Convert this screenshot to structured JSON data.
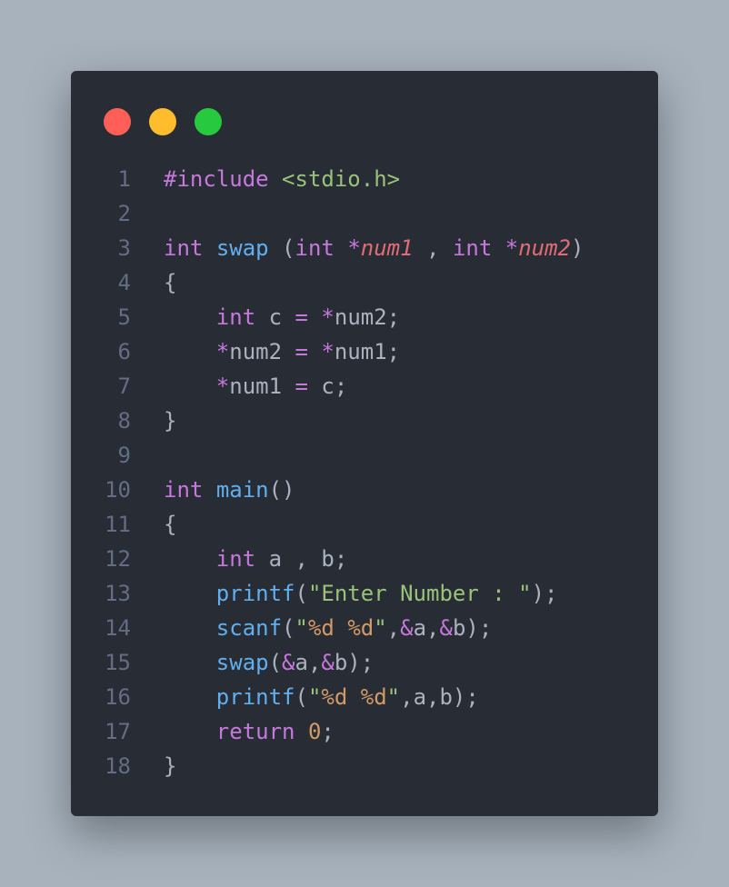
{
  "window": {
    "controls": {
      "close_color": "#ff5f56",
      "minimize_color": "#ffbd2e",
      "maximize_color": "#27c93f"
    }
  },
  "editor": {
    "language": "c",
    "lines": [
      {
        "number": "1",
        "tokens": [
          {
            "text": "#include",
            "class": "kw"
          },
          {
            "text": " ",
            "class": "txtc"
          },
          {
            "text": "<stdio.h>",
            "class": "str"
          }
        ]
      },
      {
        "number": "2",
        "tokens": []
      },
      {
        "number": "3",
        "tokens": [
          {
            "text": "int",
            "class": "kw"
          },
          {
            "text": " ",
            "class": "txtc"
          },
          {
            "text": "swap",
            "class": "fn"
          },
          {
            "text": " (",
            "class": "txtc"
          },
          {
            "text": "int",
            "class": "kw"
          },
          {
            "text": " ",
            "class": "txtc"
          },
          {
            "text": "*",
            "class": "kw"
          },
          {
            "text": "num1",
            "class": "param"
          },
          {
            "text": " , ",
            "class": "txtc"
          },
          {
            "text": "int",
            "class": "kw"
          },
          {
            "text": " ",
            "class": "txtc"
          },
          {
            "text": "*",
            "class": "kw"
          },
          {
            "text": "num2",
            "class": "param"
          },
          {
            "text": ")",
            "class": "txtc"
          }
        ]
      },
      {
        "number": "4",
        "tokens": [
          {
            "text": "{",
            "class": "txtc"
          }
        ]
      },
      {
        "number": "5",
        "tokens": [
          {
            "text": "    ",
            "class": "txtc"
          },
          {
            "text": "int",
            "class": "kw"
          },
          {
            "text": " c ",
            "class": "txtc"
          },
          {
            "text": "=",
            "class": "kw"
          },
          {
            "text": " ",
            "class": "txtc"
          },
          {
            "text": "*",
            "class": "kw"
          },
          {
            "text": "num2;",
            "class": "txtc"
          }
        ]
      },
      {
        "number": "6",
        "tokens": [
          {
            "text": "    ",
            "class": "txtc"
          },
          {
            "text": "*",
            "class": "kw"
          },
          {
            "text": "num2 ",
            "class": "txtc"
          },
          {
            "text": "=",
            "class": "kw"
          },
          {
            "text": " ",
            "class": "txtc"
          },
          {
            "text": "*",
            "class": "kw"
          },
          {
            "text": "num1;",
            "class": "txtc"
          }
        ]
      },
      {
        "number": "7",
        "tokens": [
          {
            "text": "    ",
            "class": "txtc"
          },
          {
            "text": "*",
            "class": "kw"
          },
          {
            "text": "num1 ",
            "class": "txtc"
          },
          {
            "text": "=",
            "class": "kw"
          },
          {
            "text": " c;",
            "class": "txtc"
          }
        ]
      },
      {
        "number": "8",
        "tokens": [
          {
            "text": "}",
            "class": "txtc"
          }
        ]
      },
      {
        "number": "9",
        "tokens": []
      },
      {
        "number": "10",
        "tokens": [
          {
            "text": "int",
            "class": "kw"
          },
          {
            "text": " ",
            "class": "txtc"
          },
          {
            "text": "main",
            "class": "fn"
          },
          {
            "text": "()",
            "class": "txtc"
          }
        ]
      },
      {
        "number": "11",
        "tokens": [
          {
            "text": "{",
            "class": "txtc"
          }
        ]
      },
      {
        "number": "12",
        "tokens": [
          {
            "text": "    ",
            "class": "txtc"
          },
          {
            "text": "int",
            "class": "kw"
          },
          {
            "text": " a , b;",
            "class": "txtc"
          }
        ]
      },
      {
        "number": "13",
        "tokens": [
          {
            "text": "    ",
            "class": "txtc"
          },
          {
            "text": "printf",
            "class": "fn"
          },
          {
            "text": "(",
            "class": "txtc"
          },
          {
            "text": "\"Enter Number : \"",
            "class": "str"
          },
          {
            "text": ");",
            "class": "txtc"
          }
        ]
      },
      {
        "number": "14",
        "tokens": [
          {
            "text": "    ",
            "class": "txtc"
          },
          {
            "text": "scanf",
            "class": "fn"
          },
          {
            "text": "(",
            "class": "txtc"
          },
          {
            "text": "\"",
            "class": "str"
          },
          {
            "text": "%d",
            "class": "num"
          },
          {
            "text": " ",
            "class": "str"
          },
          {
            "text": "%d",
            "class": "num"
          },
          {
            "text": "\"",
            "class": "str"
          },
          {
            "text": ",",
            "class": "txtc"
          },
          {
            "text": "&",
            "class": "kw"
          },
          {
            "text": "a,",
            "class": "txtc"
          },
          {
            "text": "&",
            "class": "kw"
          },
          {
            "text": "b);",
            "class": "txtc"
          }
        ]
      },
      {
        "number": "15",
        "tokens": [
          {
            "text": "    ",
            "class": "txtc"
          },
          {
            "text": "swap",
            "class": "fn"
          },
          {
            "text": "(",
            "class": "txtc"
          },
          {
            "text": "&",
            "class": "kw"
          },
          {
            "text": "a,",
            "class": "txtc"
          },
          {
            "text": "&",
            "class": "kw"
          },
          {
            "text": "b);",
            "class": "txtc"
          }
        ]
      },
      {
        "number": "16",
        "tokens": [
          {
            "text": "    ",
            "class": "txtc"
          },
          {
            "text": "printf",
            "class": "fn"
          },
          {
            "text": "(",
            "class": "txtc"
          },
          {
            "text": "\"",
            "class": "str"
          },
          {
            "text": "%d",
            "class": "num"
          },
          {
            "text": " ",
            "class": "str"
          },
          {
            "text": "%d",
            "class": "num"
          },
          {
            "text": "\"",
            "class": "str"
          },
          {
            "text": ",a,b);",
            "class": "txtc"
          }
        ]
      },
      {
        "number": "17",
        "tokens": [
          {
            "text": "    ",
            "class": "txtc"
          },
          {
            "text": "return",
            "class": "kw"
          },
          {
            "text": " ",
            "class": "txtc"
          },
          {
            "text": "0",
            "class": "num"
          },
          {
            "text": ";",
            "class": "txtc"
          }
        ]
      },
      {
        "number": "18",
        "tokens": [
          {
            "text": "}",
            "class": "txtc"
          }
        ]
      }
    ]
  }
}
